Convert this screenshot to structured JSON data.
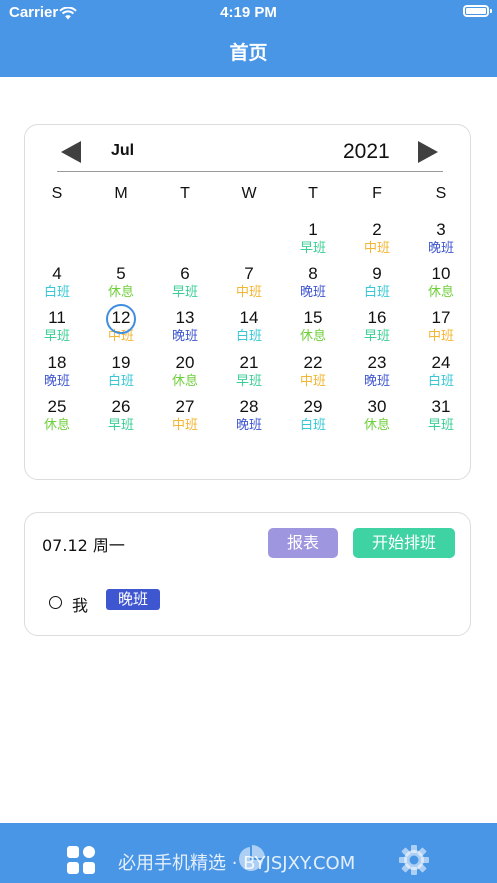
{
  "status_bar": {
    "carrier": "Carrier",
    "time": "4:19 PM"
  },
  "nav": {
    "title": "首页"
  },
  "calendar": {
    "month": "Jul",
    "year": "2021",
    "weekdays": [
      "S",
      "M",
      "T",
      "W",
      "T",
      "F",
      "S"
    ],
    "today": "12",
    "days": [
      {
        "day": "1",
        "shift": "早班"
      },
      {
        "day": "2",
        "shift": "中班"
      },
      {
        "day": "3",
        "shift": "晚班"
      },
      {
        "day": "4",
        "shift": "白班"
      },
      {
        "day": "5",
        "shift": "休息"
      },
      {
        "day": "6",
        "shift": "早班"
      },
      {
        "day": "7",
        "shift": "中班"
      },
      {
        "day": "8",
        "shift": "晚班"
      },
      {
        "day": "9",
        "shift": "白班"
      },
      {
        "day": "10",
        "shift": "休息"
      },
      {
        "day": "11",
        "shift": "早班"
      },
      {
        "day": "12",
        "shift": "中班"
      },
      {
        "day": "13",
        "shift": "晚班"
      },
      {
        "day": "14",
        "shift": "白班"
      },
      {
        "day": "15",
        "shift": "休息"
      },
      {
        "day": "16",
        "shift": "早班"
      },
      {
        "day": "17",
        "shift": "中班"
      },
      {
        "day": "18",
        "shift": "晚班"
      },
      {
        "day": "19",
        "shift": "白班"
      },
      {
        "day": "20",
        "shift": "休息"
      },
      {
        "day": "21",
        "shift": "早班"
      },
      {
        "day": "22",
        "shift": "中班"
      },
      {
        "day": "23",
        "shift": "晚班"
      },
      {
        "day": "24",
        "shift": "白班"
      },
      {
        "day": "25",
        "shift": "休息"
      },
      {
        "day": "26",
        "shift": "早班"
      },
      {
        "day": "27",
        "shift": "中班"
      },
      {
        "day": "28",
        "shift": "晚班"
      },
      {
        "day": "29",
        "shift": "白班"
      },
      {
        "day": "30",
        "shift": "休息"
      },
      {
        "day": "31",
        "shift": "早班"
      }
    ],
    "shift_colors": {
      "早班": "#3bcf95",
      "中班": "#f2b632",
      "晚班": "#3f56d1",
      "白班": "#37c8d6",
      "休息": "#6fcf3a"
    }
  },
  "detail": {
    "date": "07.12 周一",
    "report_button": "报表",
    "start_button": "开始排班",
    "person": "我",
    "person_shift": "晚班"
  },
  "tabbar": {
    "watermark": "必用手机精选 · BYJSJXY.COM",
    "icons": [
      "apps-icon",
      "chart-pie-icon",
      "settings-gear-icon"
    ]
  },
  "colors": {
    "primary": "#4a96e6",
    "report": "#9f96e0",
    "start": "#3fd2a2",
    "today_ring": "#3f8ee0"
  }
}
